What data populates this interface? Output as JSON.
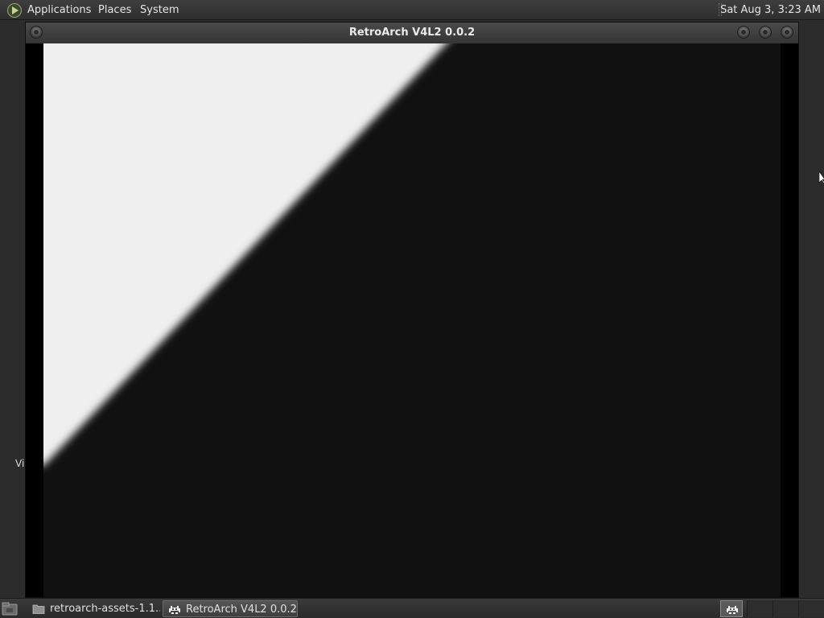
{
  "top_panel": {
    "menus": [
      "Applications",
      "Places",
      "System"
    ],
    "clock": "Sat Aug  3,  3:23 AM"
  },
  "desktop": {
    "icon_label": "Vi"
  },
  "window": {
    "title": "RetroArch V4L2 0.0.2"
  },
  "taskbar": {
    "tasks": [
      {
        "label": "retroarch-assets-1.1...",
        "icon": "folder-icon"
      },
      {
        "label": "RetroArch V4L2 0.0.2",
        "icon": "retroarch-invader-icon"
      }
    ],
    "tray_icon": "retroarch-invader-icon"
  }
}
